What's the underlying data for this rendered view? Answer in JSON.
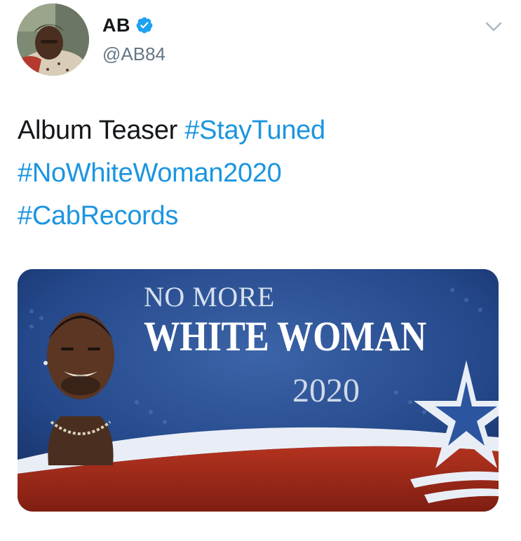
{
  "author": {
    "display_name": "AB",
    "handle": "@AB84",
    "verified": true,
    "avatar_icon": "avatar-photo"
  },
  "tweet": {
    "text_plain": "Album Teaser",
    "hashtags": [
      "#StayTuned",
      "#NoWhiteWoman2020",
      "#CabRecords"
    ]
  },
  "media": {
    "line1": "NO MORE",
    "line2": "WHITE WOMAN",
    "line3": "2020"
  },
  "colors": {
    "link": "#1b95e0",
    "text": "#14171a",
    "secondary": "#657786",
    "verified": "#1da1f2"
  },
  "icons": {
    "verified": "verified-badge-icon",
    "caret": "chevron-down-icon"
  }
}
